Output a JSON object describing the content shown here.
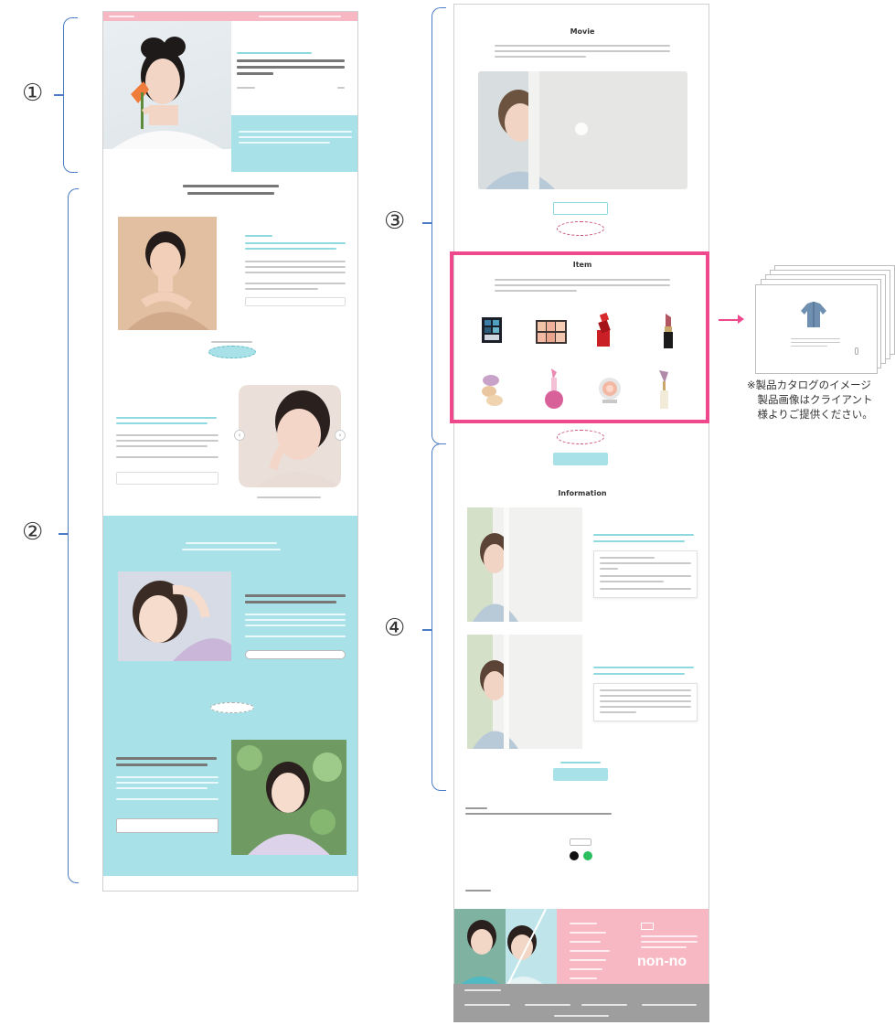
{
  "labels": {
    "section1": "①",
    "section2": "②",
    "section3": "③",
    "section4": "④"
  },
  "right_page": {
    "movie_heading": "Movie",
    "item_heading": "Item",
    "information_heading": "Information"
  },
  "logo": "non-no",
  "note": {
    "line1": "※製品カタログのイメージ",
    "line2": "　製品画像はクライアント",
    "line3": "　様よりご提供ください。"
  },
  "colors": {
    "accent_pink": "#f0488c",
    "bracket_blue": "#4a7bc4",
    "teal": "#a8e2e8",
    "header_pink": "#f7b8c4",
    "footer_gray": "#9e9e9e"
  },
  "icons": [
    "bracket",
    "arrow-right-icon",
    "play-icon",
    "x-social-icon",
    "line-social-icon",
    "chevron-left-icon",
    "chevron-right-icon"
  ]
}
